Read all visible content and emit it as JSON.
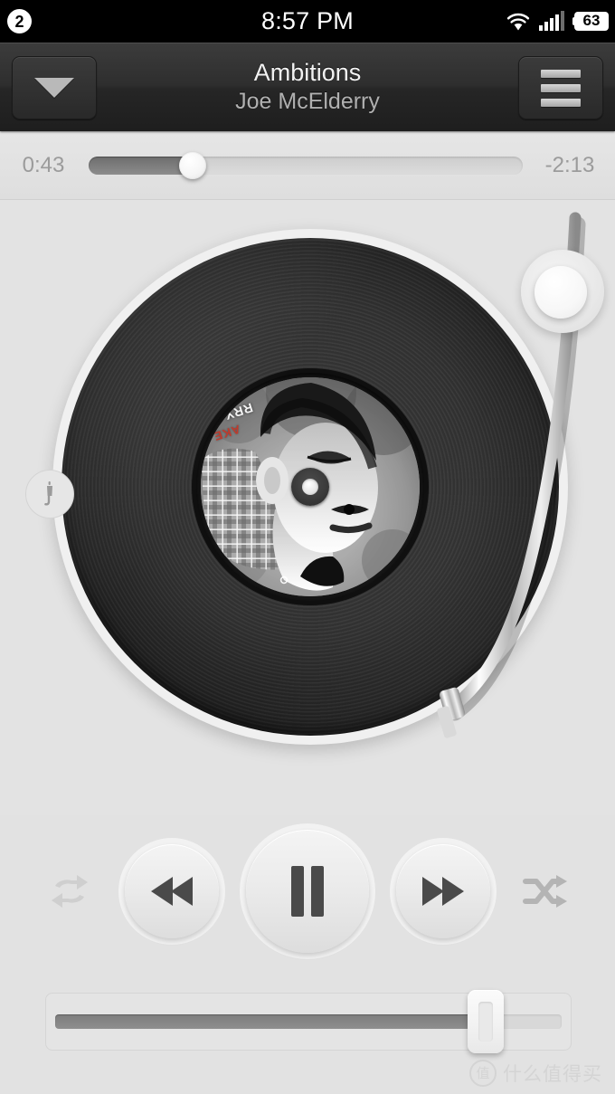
{
  "status_bar": {
    "notification_count": "2",
    "clock": "8:57 PM",
    "wifi_icon": "wifi-icon",
    "signal_icon": "cellular-signal-icon",
    "battery_level": "63"
  },
  "nav_bar": {
    "collapse_icon": "chevron-down-icon",
    "menu_icon": "hamburger-menu-icon",
    "title": "Ambitions",
    "subtitle": "Joe McElderry"
  },
  "progress": {
    "elapsed": "0:43",
    "remaining": "-2:13",
    "percent": 24
  },
  "turntable": {
    "needle_button_icon": "tonearm-needle-icon",
    "album_art_text_red": "AKE",
    "album_art_text_white": "RRY",
    "tonearm_pivot": "tonearm-pivot-knob",
    "headshell": "tonearm-headshell"
  },
  "controls": {
    "repeat_label": "Repeat",
    "repeat_icon": "repeat-icon",
    "repeat_active": false,
    "previous_label": "Rewind",
    "previous_icon": "rewind-icon",
    "play_pause_label": "Pause",
    "play_pause_icon": "pause-icon",
    "next_label": "Fast Forward",
    "next_icon": "fast-forward-icon",
    "shuffle_label": "Shuffle",
    "shuffle_icon": "shuffle-icon",
    "shuffle_active": true
  },
  "volume": {
    "percent": 85,
    "label": "Volume"
  },
  "watermark": {
    "logo_char": "值",
    "text": "什么值得买"
  },
  "colors": {
    "background": "#e3e3e3",
    "nav_dark": "#2e2e2e",
    "status_black": "#000000",
    "fill_gray": "#7d7d7d",
    "text_light": "#f2f2f2",
    "text_muted": "#9b9b9b",
    "art_red": "#c0392b"
  }
}
